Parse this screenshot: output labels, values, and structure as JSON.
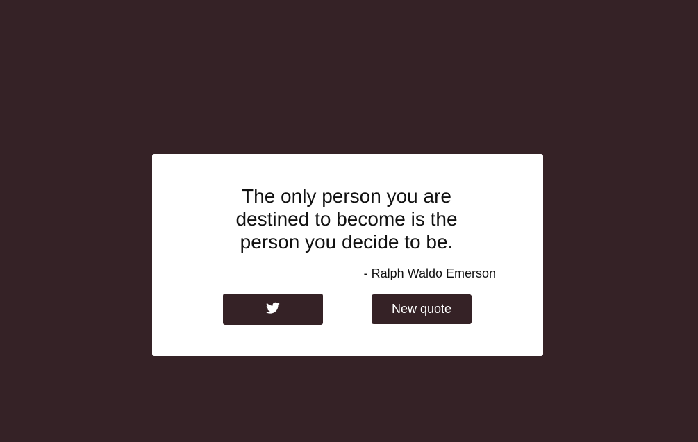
{
  "quote": {
    "text": "The only person you are destined to become is the person you decide to be.",
    "author": "- Ralph Waldo Emerson"
  },
  "buttons": {
    "tweet_icon": "twitter-icon",
    "new_quote_label": "New quote"
  },
  "colors": {
    "background": "#352226",
    "card": "#ffffff",
    "button": "#352226",
    "text": "#111111"
  }
}
